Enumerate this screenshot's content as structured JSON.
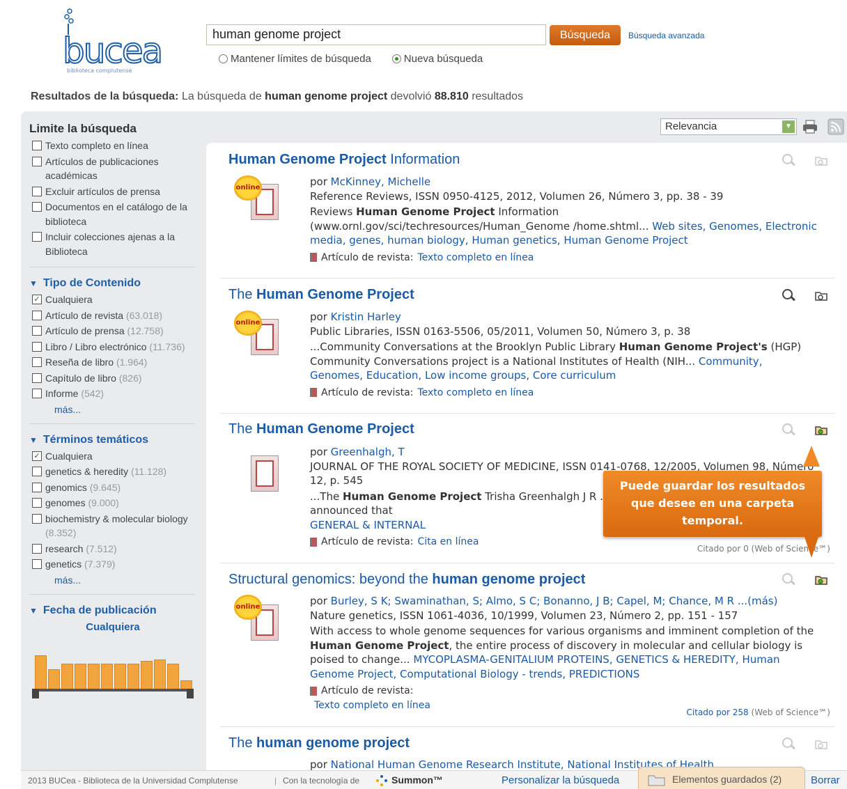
{
  "header": {
    "logo_text": "bucea",
    "logo_subtitle": "biblioteca complutense",
    "search_value": "human genome project",
    "search_button": "Búsqueda",
    "advanced_link": "Búsqueda avanzada",
    "radio_keep": "Mantener límites de búsqueda",
    "radio_new": "Nueva búsqueda"
  },
  "summary": {
    "label": "Resultados de la búsqueda:",
    "pre": "La búsqueda de",
    "query": "human genome project",
    "mid": "devolvió",
    "count": "88.810",
    "post": "resultados"
  },
  "sort": {
    "value": "Relevancia"
  },
  "sidebar": {
    "limit_title": "Limite la búsqueda",
    "limits": [
      "Texto completo en línea",
      "Artículos de publicaciones académicas",
      "Excluir artículos de prensa",
      "Documentos en el catálogo de la biblioteca",
      "Incluir colecciones ajenas a la Biblioteca"
    ],
    "content_title": "Tipo de Contenido",
    "content_any": "Cualquiera",
    "content_types": [
      {
        "label": "Artículo de revista",
        "count": "(63.018)"
      },
      {
        "label": "Artículo de prensa",
        "count": "(12.758)"
      },
      {
        "label": "Libro / Libro electrónico",
        "count": "(11.736)"
      },
      {
        "label": "Reseña de libro",
        "count": "(1.964)"
      },
      {
        "label": "Capítulo de libro",
        "count": "(826)"
      },
      {
        "label": "Informe",
        "count": "(542)"
      }
    ],
    "more_1": "más...",
    "subject_title": "Términos temáticos",
    "subject_any": "Cualquiera",
    "subjects": [
      {
        "label": "genetics & heredity",
        "count": "(11.128)"
      },
      {
        "label": "genomics",
        "count": "(9.645)"
      },
      {
        "label": "genomes",
        "count": "(9.000)"
      },
      {
        "label": "biochemistry & molecular biology",
        "count": "(8.352)"
      },
      {
        "label": "research",
        "count": "(7.512)"
      },
      {
        "label": "genetics",
        "count": "(7.379)"
      }
    ],
    "more_2": "más...",
    "date_title": "Fecha de publicación",
    "date_any": "Cualquiera"
  },
  "results": [
    {
      "title_pre": "",
      "title_bold": "Human Genome Project",
      "title_post": " Information",
      "by": "por",
      "author": "McKinney, Michelle",
      "source": "Reference Reviews, ISSN 0950-4125, 2012, Volumen 26, Número 3, pp. 38 - 39",
      "snippet_pre": "Reviews ",
      "snippet_bold": "Human Genome Project",
      "snippet_post": " Information (www.ornl.gov/sci/techresources/Human_Genome /home.shtml...",
      "keywords": "Web sites, Genomes, Electronic media, genes, human biology, Human genetics, Human Genome Project",
      "type": "Artículo de revista:",
      "access": "Texto completo en línea",
      "online": "online"
    },
    {
      "title_pre": "The ",
      "title_bold": "Human Genome Project",
      "title_post": "",
      "by": "por",
      "author": "Kristin Harley",
      "source": "Public Libraries, ISSN 0163-5506, 05/2011, Volumen 50, Número 3, p. 38",
      "snippet_pre": "...Community Conversations at the Brooklyn Public Library ",
      "snippet_bold": "Human Genome Project's",
      "snippet_post": " (HGP) Community Conversations project is a National Institutes of Health (NIH...",
      "keywords": "Community, Genomes, Education, Low income groups, Core curriculum",
      "type": "Artículo de revista:",
      "access": "Texto completo en línea",
      "online": "online"
    },
    {
      "title_pre": "The ",
      "title_bold": "Human Genome Project",
      "title_post": "",
      "by": "por",
      "author": "Greenhalgh, T",
      "source": "JOURNAL OF THE ROYAL SOCIETY OF MEDICINE, ISSN 0141-0768, 12/2005, Volumen 98, Número 12, p. 545",
      "snippet_pre": "...The ",
      "snippet_bold": "Human Genome Project",
      "snippet_post": " Trisha Greenhalgh J R ... US Human Genome Research Institute announced that",
      "keywords": "GENERAL & INTERNAL",
      "type": "Artículo de revista:",
      "access": "Cita en línea",
      "cited": "Citado por 0 (Web of Science℠)"
    },
    {
      "title_pre": "Structural genomics: beyond the ",
      "title_bold": "human genome project",
      "title_post": "",
      "by": "por",
      "author": "Burley, S K; Swaminathan, S; Almo, S C; Bonanno, J B; Capel, M; Chance, M R ...(más)",
      "source": "Nature genetics, ISSN 1061-4036, 10/1999, Volumen 23, Número 2, pp. 151 - 157",
      "snippet_pre": "With access to whole genome sequences for various organisms and imminent completion of the ",
      "snippet_bold": "Human Genome Project",
      "snippet_post": ", the entire process of discovery in molecular and cellular biology is poised to change...",
      "keywords": "MYCOPLASMA-GENITALIUM PROTEINS, GENETICS & HEREDITY, Human Genome Project, Computational Biology - trends, PREDICTIONS",
      "type": "Artículo de revista:",
      "access": "Texto completo en línea",
      "online": "online",
      "cited_link": "Citado por 258",
      "cited_src": "(Web of Science℠)"
    },
    {
      "title_pre": "The ",
      "title_bold": "human genome project",
      "title_post": "",
      "by": "por",
      "author": "National Human Genome Research Institute, National Institutes of Health"
    }
  ],
  "tooltip": "Puede guardar los resultados que desee en una carpeta temporal.",
  "footer": {
    "copyright": "2013 BUCea - Biblioteca de la Universidad Complutense",
    "powered": "Con la tecnología de",
    "summon": "Summon™",
    "customize": "Personalizar la búsqueda",
    "saved": "Elementos guardados (2)",
    "delete": "Borrar"
  },
  "colors": {
    "accent": "#1a5aa6",
    "orange": "#e07a2a",
    "panel": "#e9ebed"
  }
}
